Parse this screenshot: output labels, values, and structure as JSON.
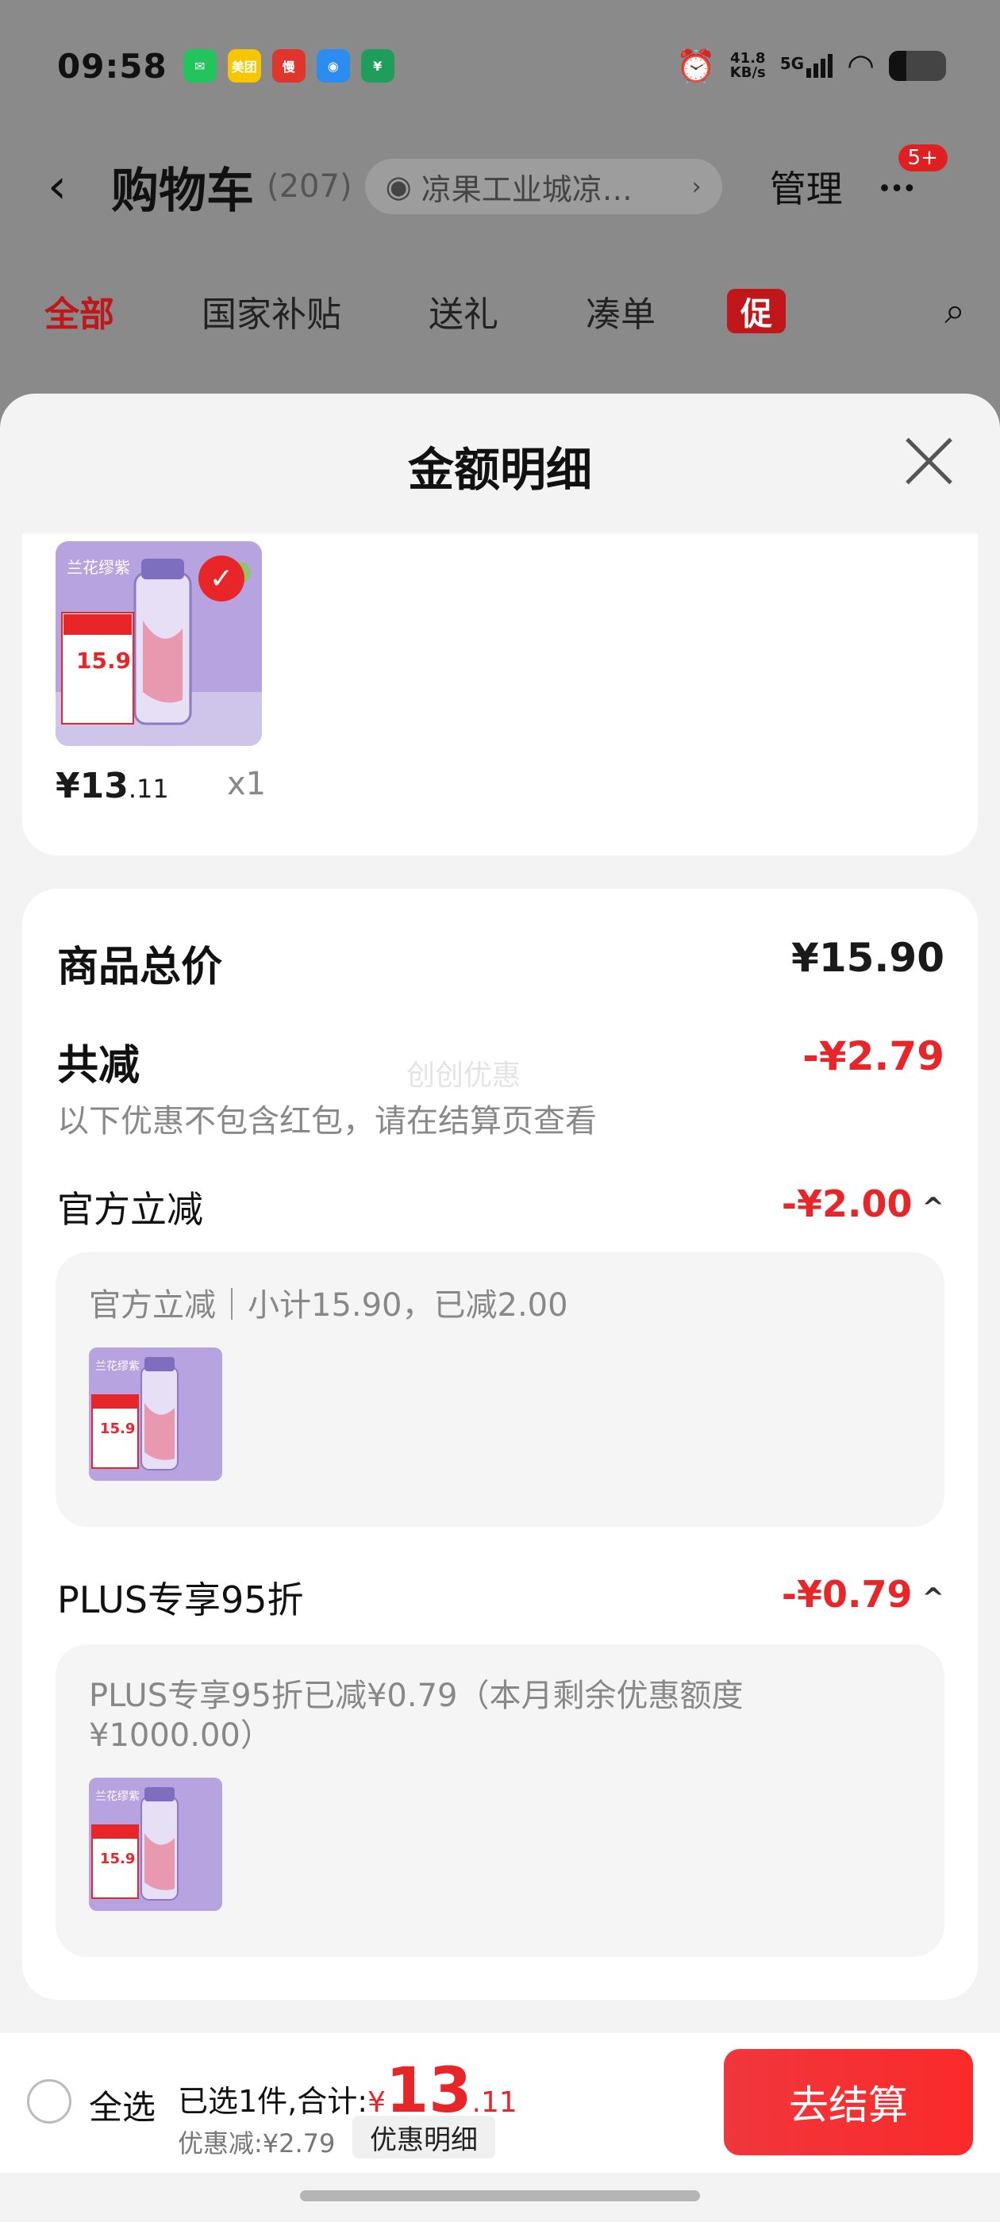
{
  "status_bar": {
    "time": "09:58",
    "apps": [
      {
        "name": "wechat-icon",
        "color": "#23c45e",
        "glyph": "✉"
      },
      {
        "name": "meituan-icon",
        "color": "#f7c600",
        "glyph": "美团"
      },
      {
        "name": "app-red-icon",
        "color": "#e0352c",
        "glyph": "慢"
      },
      {
        "name": "app-blue-icon",
        "color": "#2d8cf0",
        "glyph": "◉"
      },
      {
        "name": "bank-icon",
        "color": "#1e9e5a",
        "glyph": "¥"
      }
    ],
    "network_speed_top": "41.8",
    "network_speed_bottom": "KB/s",
    "signal_label": "5G",
    "battery_level": 0.3
  },
  "header": {
    "back_glyph": "‹",
    "title": "购物车",
    "count": "(207)",
    "location": "凉果工业城凉…",
    "location_arrow": "›",
    "manage": "管理",
    "more_glyph": "•••",
    "more_badge": "5+"
  },
  "tabs": [
    {
      "label": "全部",
      "active": true
    },
    {
      "label": "国家补贴",
      "active": false
    },
    {
      "label": "送礼",
      "active": false
    },
    {
      "label": "凑单",
      "active": false
    }
  ],
  "promo_tab": "促",
  "sheet": {
    "title": "金额明细",
    "product": {
      "price_int": "¥13",
      "price_dec": ".11",
      "qty": "x1",
      "image_label": "兰花缪紫",
      "image_price": "15.9"
    },
    "total_label": "商品总价",
    "total_value": "¥15.90",
    "reduce_label": "共减",
    "reduce_value": "-¥2.79",
    "reduce_note": "以下优惠不包含红包，请在结算页查看",
    "watermark": "创创优惠",
    "official": {
      "label": "官方立减",
      "value": "-¥2.00",
      "caret": "^",
      "detail": "官方立减｜小计15.90，已减2.00"
    },
    "plus": {
      "label": "PLUS专享95折",
      "value": "-¥0.79",
      "caret": "^",
      "detail_line1": "PLUS专享95折已减¥0.79（本月剩余优惠额度",
      "detail_line2": "¥1000.00）"
    }
  },
  "bottom_bar": {
    "select_all": "全选",
    "summary_prefix": "已选1件,合计:",
    "summary_yen": "¥",
    "summary_big": "13",
    "summary_small": ".11",
    "discount": "优惠减:¥2.79",
    "detail_chip": "优惠明细",
    "checkout": "去结算"
  },
  "colors": {
    "accent": "#e8262a",
    "tab_active": "#c0171a",
    "product_purple": "#b7a3df"
  }
}
